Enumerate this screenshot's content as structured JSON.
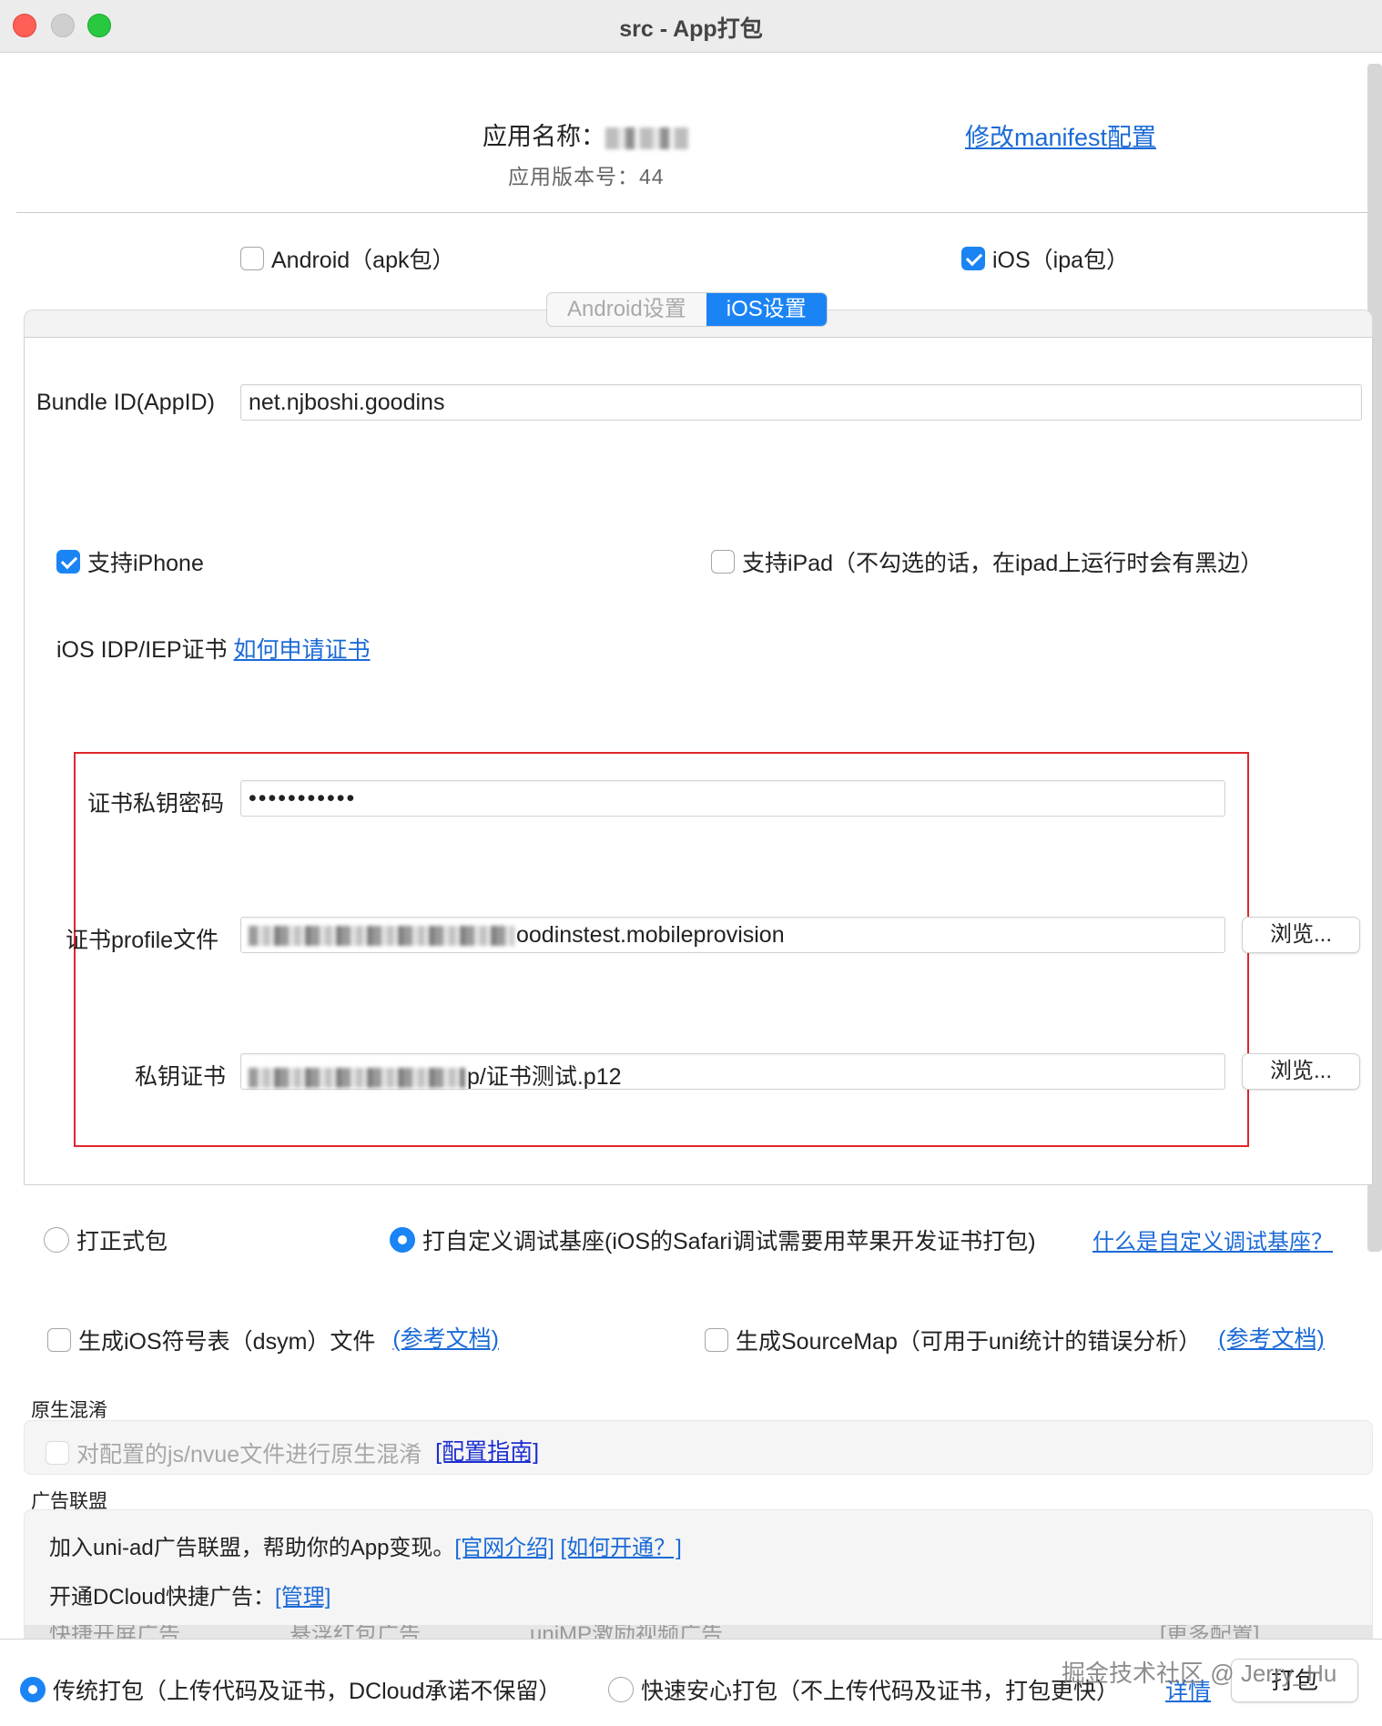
{
  "window": {
    "title": "src - App打包"
  },
  "header": {
    "app_name_label": "应用名称：",
    "app_version": "应用版本号：44",
    "manifest_link": "修改manifest配置"
  },
  "platforms": {
    "android": {
      "label": "Android（apk包）",
      "checked": false
    },
    "ios": {
      "label": "iOS（ipa包）",
      "checked": true
    }
  },
  "tabs": [
    {
      "label": "Android设置",
      "active": false
    },
    {
      "label": "iOS设置",
      "active": true
    }
  ],
  "ios_settings": {
    "bundle_id_label": "Bundle ID(AppID)",
    "bundle_id_value": "net.njboshi.goodins",
    "support_iphone": {
      "label": "支持iPhone",
      "checked": true
    },
    "support_ipad": {
      "label": "支持iPad（不勾选的话，在ipad上运行时会有黑边）",
      "checked": false
    },
    "cert_section_label": "iOS IDP/IEP证书",
    "cert_help_link": "如何申请证书",
    "cert_password_label": "证书私钥密码",
    "cert_password_value": "•••••••••••",
    "profile_label": "证书profile文件",
    "profile_value_suffix": "oodinstest.mobileprovision",
    "private_cert_label": "私钥证书",
    "private_cert_value_suffix": "p/证书测试.p12",
    "browse_label": "浏览..."
  },
  "build_type": {
    "formal": {
      "label": "打正式包",
      "checked": false
    },
    "custom_base": {
      "label": "打自定义调试基座(iOS的Safari调试需要用苹果开发证书打包)",
      "checked": true
    },
    "help_link": "什么是自定义调试基座？"
  },
  "extras": {
    "dsym": {
      "label": "生成iOS符号表（dsym）文件",
      "link": "(参考文档)",
      "checked": false
    },
    "sourcemap": {
      "label": "生成SourceMap（可用于uni统计的错误分析）",
      "link": "(参考文档)",
      "checked": false
    }
  },
  "native_obfuscation": {
    "title": "原生混淆",
    "option_label": "对配置的js/nvue文件进行原生混淆",
    "link": "[配置指南]"
  },
  "ad_alliance": {
    "title": "广告联盟",
    "intro": "加入uni-ad广告联盟，帮助你的App变现。",
    "intro_link1": "[官网介绍]",
    "intro_link2": "[如何开通？]",
    "quick_ads": "开通DCloud快捷广告：",
    "quick_ads_link": "[管理]",
    "partial_row": "快捷开屏广告　　　　　悬浮红包广告　　　　　uniMP激励视频广告　　　　　　　　　　　　　　　　　　　　[更多配置]"
  },
  "footer": {
    "traditional": {
      "label": "传统打包（上传代码及证书，DCloud承诺不保留）",
      "checked": true
    },
    "fast": {
      "label": "快速安心打包（不上传代码及证书，打包更快）",
      "checked": false
    },
    "details_link": "详情",
    "pack_button": "打包",
    "watermark": "掘金技术社区 @ Jerry_Hu"
  },
  "colors": {
    "accent": "#1b84f5",
    "link": "#1b6ad6",
    "highlight_box": "#e0262b"
  }
}
